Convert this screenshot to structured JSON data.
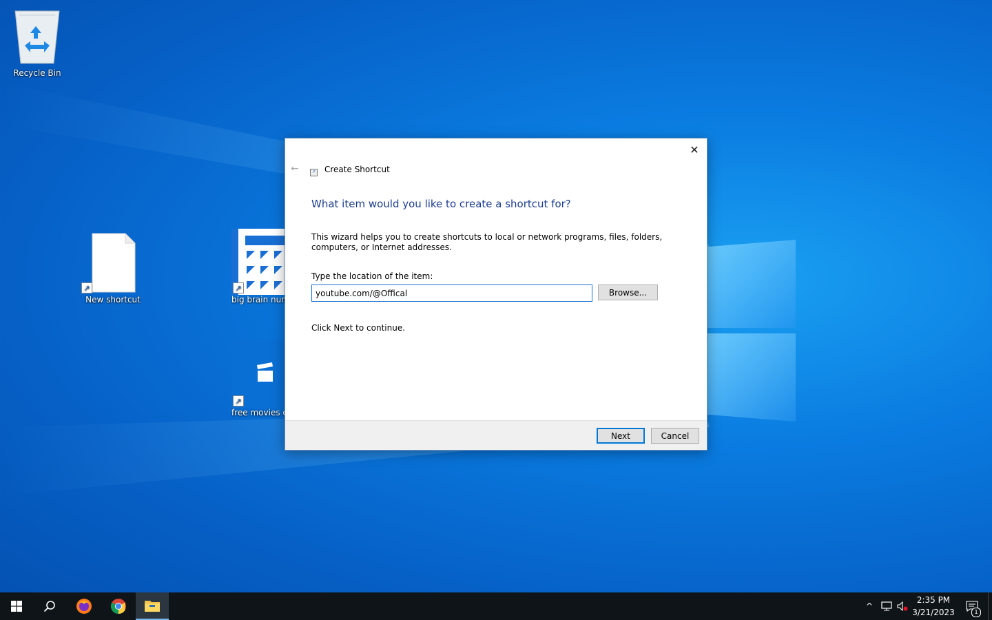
{
  "desktop": {
    "icons": [
      {
        "label": "Recycle Bin"
      },
      {
        "label": "New shortcut"
      },
      {
        "label": "big brain num"
      },
      {
        "label": "free movies on"
      }
    ]
  },
  "dialog": {
    "title": "Create Shortcut",
    "heading": "What item would you like to create a shortcut for?",
    "description": "This wizard helps you to create shortcuts to local or network programs, files, folders, computers, or Internet addresses.",
    "location_label": "Type the location of the item:",
    "location_value": "youtube.com/@Offical",
    "browse_label": "Browse...",
    "continue_text": "Click Next to continue.",
    "next_label": "Next",
    "cancel_label": "Cancel"
  },
  "taskbar": {
    "apps": [
      {
        "icon": "windows-start-icon"
      },
      {
        "icon": "search-icon"
      },
      {
        "icon": "firefox-icon"
      },
      {
        "icon": "chrome-icon"
      },
      {
        "icon": "file-explorer-icon",
        "active": true
      }
    ],
    "clock": {
      "time": "2:35 PM",
      "date": "3/21/2023"
    },
    "notification_count": "1"
  }
}
